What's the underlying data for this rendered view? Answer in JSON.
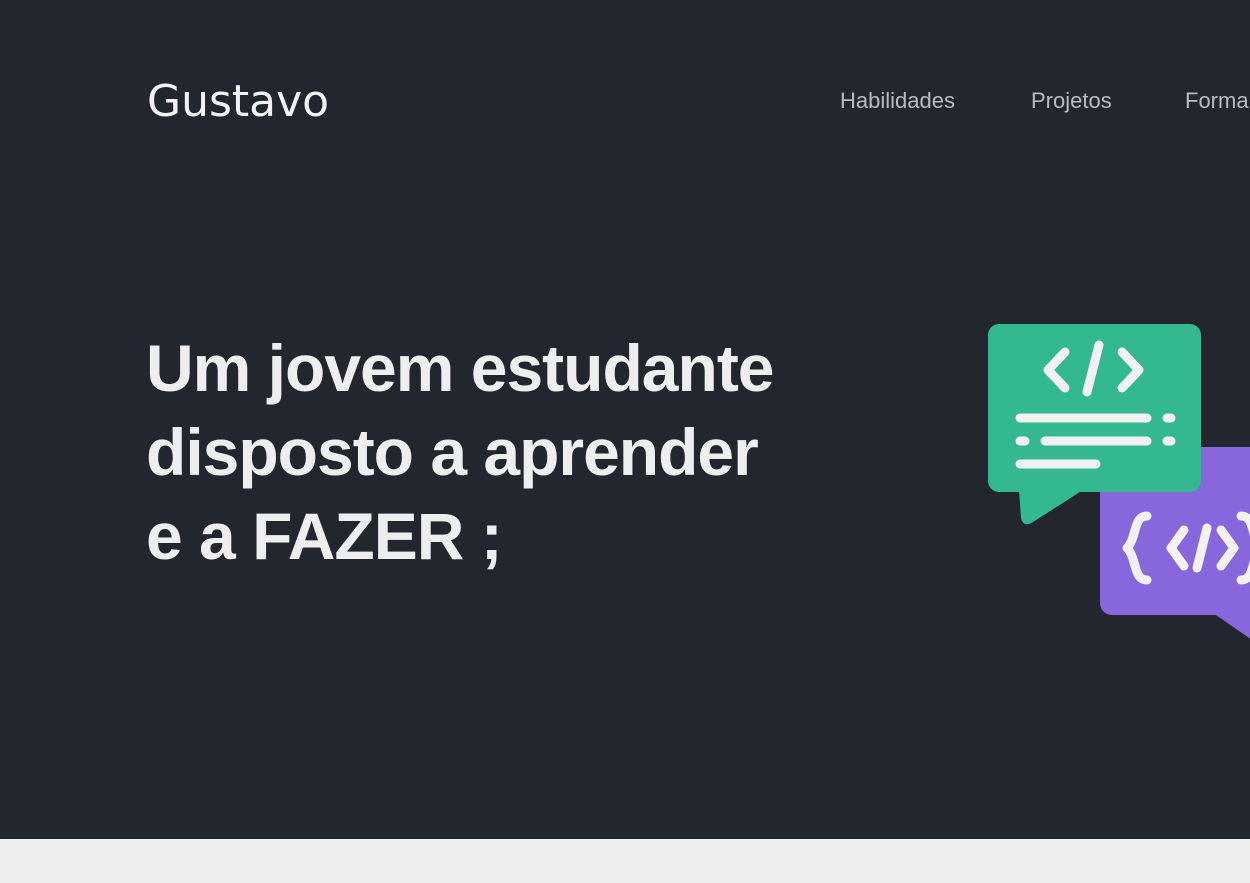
{
  "page": {
    "background": "#22272f",
    "footer_background": "#eeeeee"
  },
  "header": {
    "logo": "Gustavo",
    "nav": [
      {
        "label": "Habilidades"
      },
      {
        "label": "Projetos"
      },
      {
        "label": "Forma"
      }
    ]
  },
  "hero": {
    "headline_lines": [
      "Um jovem estudante",
      "disposto a aprender",
      "e a FAZER ;"
    ],
    "illustration": {
      "icon": "code-chat-bubbles-icon",
      "colors": {
        "front_bubble": "#33b890",
        "back_bubble": "#8767db",
        "glyphs": "#f2f2f2"
      }
    }
  }
}
